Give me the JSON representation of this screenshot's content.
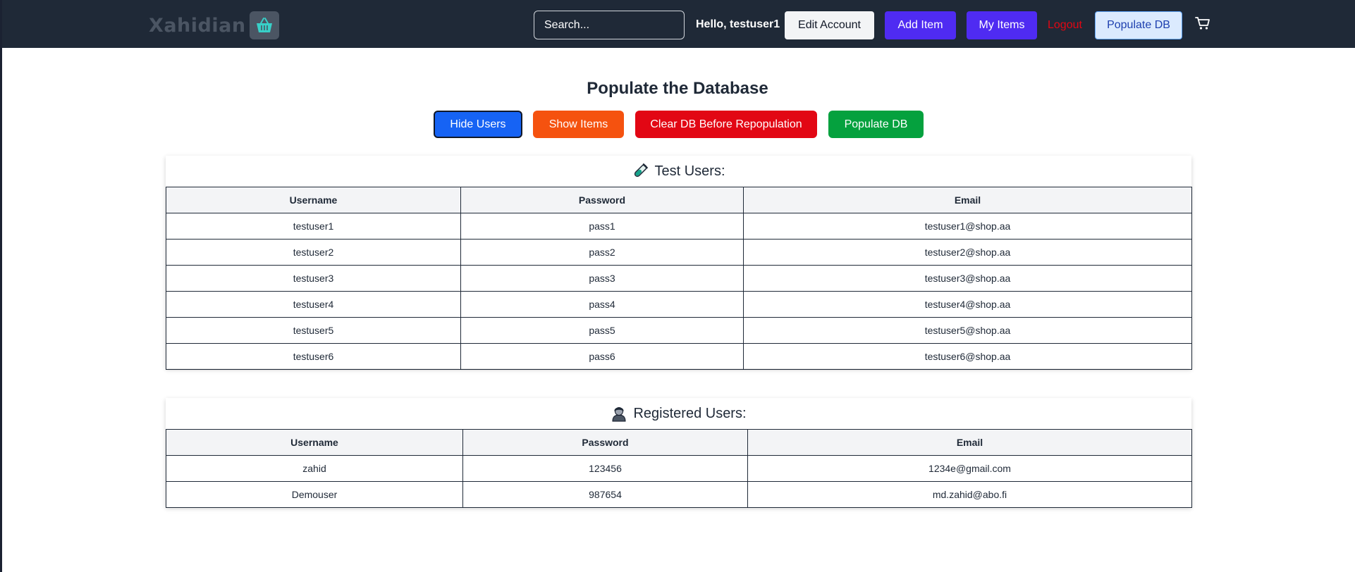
{
  "navbar": {
    "brand": "Xahidian",
    "brand_icon": "basket-icon",
    "search_placeholder": "Search...",
    "greeting": "Hello, testuser1",
    "edit_account": "Edit Account",
    "add_item": "Add Item",
    "my_items": "My Items",
    "logout": "Logout",
    "populate_db": "Populate DB",
    "cart_icon": "cart-icon"
  },
  "main": {
    "title": "Populate the Database",
    "buttons": {
      "hide_users": "Hide Users",
      "show_items": "Show Items",
      "clear_db": "Clear DB Before Repopulation",
      "populate_db": "Populate DB"
    }
  },
  "test_users": {
    "heading": "Test Users:",
    "icon": "test-tube-icon",
    "columns": [
      "Username",
      "Password",
      "Email"
    ],
    "rows": [
      [
        "testuser1",
        "pass1",
        "testuser1@shop.aa"
      ],
      [
        "testuser2",
        "pass2",
        "testuser2@shop.aa"
      ],
      [
        "testuser3",
        "pass3",
        "testuser3@shop.aa"
      ],
      [
        "testuser4",
        "pass4",
        "testuser4@shop.aa"
      ],
      [
        "testuser5",
        "pass5",
        "testuser5@shop.aa"
      ],
      [
        "testuser6",
        "pass6",
        "testuser6@shop.aa"
      ]
    ]
  },
  "registered_users": {
    "heading": "Registered Users:",
    "icon": "user-icon",
    "columns": [
      "Username",
      "Password",
      "Email"
    ],
    "rows": [
      [
        "zahid",
        "123456",
        "1234e@gmail.com"
      ],
      [
        "Demouser",
        "987654",
        "md.zahid@abo.fi"
      ]
    ]
  },
  "colors": {
    "navbar_bg": "#1f2937",
    "primary_purple": "#4f2bf2",
    "blue": "#1663f4",
    "orange": "#f5520f",
    "red": "#e20714",
    "green": "#05a13e",
    "logout_red": "#e30613"
  }
}
